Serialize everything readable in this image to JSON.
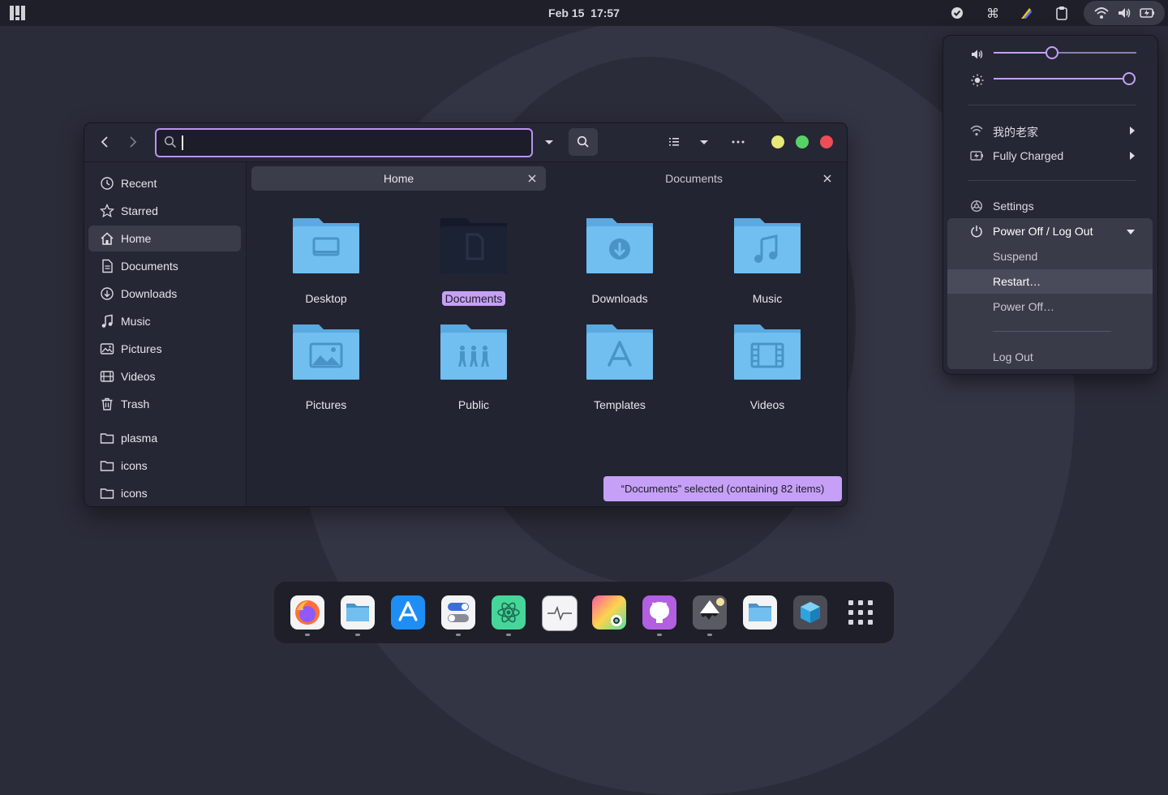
{
  "topbar": {
    "date": "Feb 15",
    "time": "17:57",
    "icons": [
      "activities-icon",
      "check-circle-icon",
      "command-icon",
      "pen-icon",
      "clipboard-icon",
      "wifi-icon",
      "volume-icon",
      "battery-charging-icon"
    ]
  },
  "file_manager": {
    "search": {
      "value": "",
      "placeholder": ""
    },
    "sidebar": {
      "items": [
        {
          "label": "Recent",
          "icon": "clock-icon"
        },
        {
          "label": "Starred",
          "icon": "star-icon"
        },
        {
          "label": "Home",
          "icon": "home-icon",
          "active": true
        },
        {
          "label": "Documents",
          "icon": "document-icon"
        },
        {
          "label": "Downloads",
          "icon": "download-icon"
        },
        {
          "label": "Music",
          "icon": "music-note-icon"
        },
        {
          "label": "Pictures",
          "icon": "image-icon"
        },
        {
          "label": "Videos",
          "icon": "film-icon"
        },
        {
          "label": "Trash",
          "icon": "trash-icon"
        }
      ],
      "bookmarks": [
        {
          "label": "plasma",
          "icon": "folder-icon"
        },
        {
          "label": "icons",
          "icon": "folder-icon"
        },
        {
          "label": "icons",
          "icon": "folder-icon"
        }
      ]
    },
    "tabs": [
      {
        "label": "Home",
        "active": true
      },
      {
        "label": "Documents",
        "active": false
      }
    ],
    "folders": [
      {
        "label": "Desktop",
        "icon": "desktop-folder-icon"
      },
      {
        "label": "Documents",
        "icon": "documents-folder-icon",
        "selected": true
      },
      {
        "label": "Downloads",
        "icon": "downloads-folder-icon"
      },
      {
        "label": "Music",
        "icon": "music-folder-icon"
      },
      {
        "label": "Pictures",
        "icon": "pictures-folder-icon"
      },
      {
        "label": "Public",
        "icon": "public-folder-icon"
      },
      {
        "label": "Templates",
        "icon": "templates-folder-icon"
      },
      {
        "label": "Videos",
        "icon": "videos-folder-icon"
      }
    ],
    "status": "“Documents” selected  (containing 82 items)"
  },
  "quick_settings": {
    "volume_level": 0.4,
    "brightness_level": 1.0,
    "wifi": {
      "label": "我的老家",
      "icon": "wifi-icon"
    },
    "battery": {
      "label": "Fully Charged",
      "icon": "battery-charging-icon"
    },
    "settings": {
      "label": "Settings",
      "icon": "settings-icon"
    },
    "power": {
      "label": "Power Off / Log Out",
      "icon": "power-icon",
      "items": [
        "Suspend",
        "Restart…",
        "Power Off…",
        "Log Out"
      ]
    }
  },
  "dock": {
    "apps": [
      {
        "name": "firefox-icon",
        "running": true
      },
      {
        "name": "files-icon",
        "running": true
      },
      {
        "name": "app-store-icon",
        "running": false
      },
      {
        "name": "tweaks-icon",
        "running": true
      },
      {
        "name": "atom-icon",
        "running": true
      },
      {
        "name": "system-monitor-icon",
        "running": false
      },
      {
        "name": "color-picker-icon",
        "running": false
      },
      {
        "name": "github-icon",
        "running": true
      },
      {
        "name": "inkscape-icon",
        "running": true
      },
      {
        "name": "folder-icon",
        "running": false
      },
      {
        "name": "box-icon",
        "running": false
      },
      {
        "name": "app-grid-icon",
        "running": false
      }
    ]
  }
}
